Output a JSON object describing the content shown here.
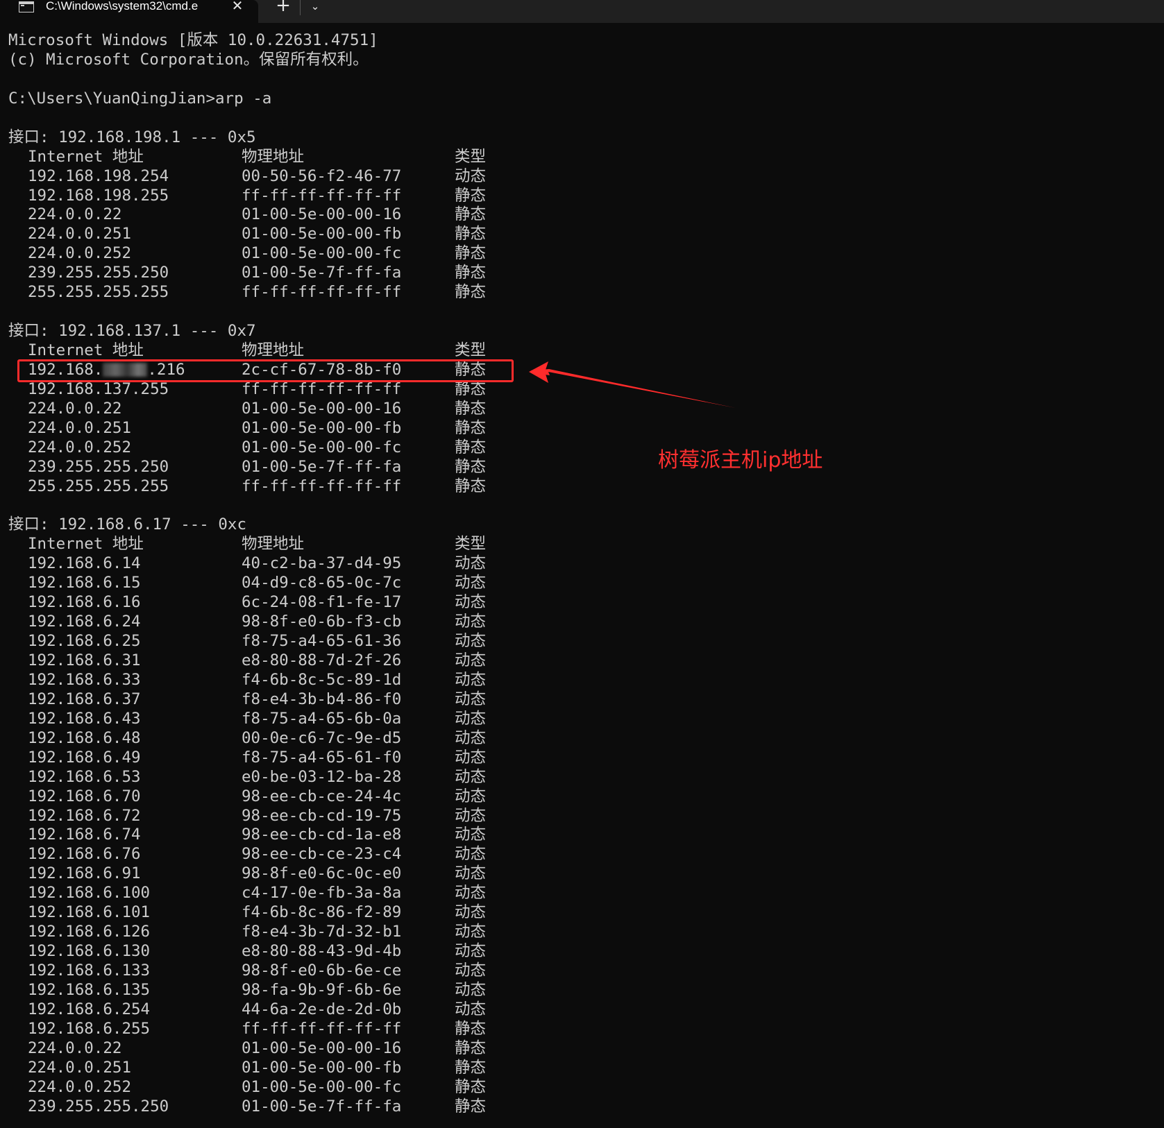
{
  "window": {
    "tab_title": "C:\\Windows\\system32\\cmd.e",
    "close_glyph": "✕",
    "new_tab_glyph": "+",
    "dropdown_glyph": "⌄",
    "icon": "terminal-icon"
  },
  "console": {
    "header_line1": "Microsoft Windows [版本 10.0.22631.4751]",
    "header_line2": "(c) Microsoft Corporation。保留所有权利。",
    "prompt": "C:\\Users\\YuanQingJian>arp -a",
    "interfaces": [
      {
        "title": "接口: 192.168.198.1 --- 0x5",
        "col_ip": "Internet 地址",
        "col_mac": "物理地址",
        "col_type": "类型",
        "rows": [
          {
            "ip": "192.168.198.254",
            "mac": "00-50-56-f2-46-77",
            "type": "动态"
          },
          {
            "ip": "192.168.198.255",
            "mac": "ff-ff-ff-ff-ff-ff",
            "type": "静态"
          },
          {
            "ip": "224.0.0.22",
            "mac": "01-00-5e-00-00-16",
            "type": "静态"
          },
          {
            "ip": "224.0.0.251",
            "mac": "01-00-5e-00-00-fb",
            "type": "静态"
          },
          {
            "ip": "224.0.0.252",
            "mac": "01-00-5e-00-00-fc",
            "type": "静态"
          },
          {
            "ip": "239.255.255.250",
            "mac": "01-00-5e-7f-ff-fa",
            "type": "静态"
          },
          {
            "ip": "255.255.255.255",
            "mac": "ff-ff-ff-ff-ff-ff",
            "type": "静态"
          }
        ]
      },
      {
        "title": "接口: 192.168.137.1 --- 0x7",
        "col_ip": "Internet 地址",
        "col_mac": "物理地址",
        "col_type": "类型",
        "highlight_row": {
          "ip_prefix": "192.168.",
          "ip_suffix": ".216",
          "mac": "2c-cf-67-78-8b-f0",
          "type": "静态"
        },
        "rows": [
          {
            "ip": "192.168.137.255",
            "mac": "ff-ff-ff-ff-ff-ff",
            "type": "静态"
          },
          {
            "ip": "224.0.0.22",
            "mac": "01-00-5e-00-00-16",
            "type": "静态"
          },
          {
            "ip": "224.0.0.251",
            "mac": "01-00-5e-00-00-fb",
            "type": "静态"
          },
          {
            "ip": "224.0.0.252",
            "mac": "01-00-5e-00-00-fc",
            "type": "静态"
          },
          {
            "ip": "239.255.255.250",
            "mac": "01-00-5e-7f-ff-fa",
            "type": "静态"
          },
          {
            "ip": "255.255.255.255",
            "mac": "ff-ff-ff-ff-ff-ff",
            "type": "静态"
          }
        ]
      },
      {
        "title": "接口: 192.168.6.17 --- 0xc",
        "col_ip": "Internet 地址",
        "col_mac": "物理地址",
        "col_type": "类型",
        "rows": [
          {
            "ip": "192.168.6.14",
            "mac": "40-c2-ba-37-d4-95",
            "type": "动态"
          },
          {
            "ip": "192.168.6.15",
            "mac": "04-d9-c8-65-0c-7c",
            "type": "动态"
          },
          {
            "ip": "192.168.6.16",
            "mac": "6c-24-08-f1-fe-17",
            "type": "动态"
          },
          {
            "ip": "192.168.6.24",
            "mac": "98-8f-e0-6b-f3-cb",
            "type": "动态"
          },
          {
            "ip": "192.168.6.25",
            "mac": "f8-75-a4-65-61-36",
            "type": "动态"
          },
          {
            "ip": "192.168.6.31",
            "mac": "e8-80-88-7d-2f-26",
            "type": "动态"
          },
          {
            "ip": "192.168.6.33",
            "mac": "f4-6b-8c-5c-89-1d",
            "type": "动态"
          },
          {
            "ip": "192.168.6.37",
            "mac": "f8-e4-3b-b4-86-f0",
            "type": "动态"
          },
          {
            "ip": "192.168.6.43",
            "mac": "f8-75-a4-65-6b-0a",
            "type": "动态"
          },
          {
            "ip": "192.168.6.48",
            "mac": "00-0e-c6-7c-9e-d5",
            "type": "动态"
          },
          {
            "ip": "192.168.6.49",
            "mac": "f8-75-a4-65-61-f0",
            "type": "动态"
          },
          {
            "ip": "192.168.6.53",
            "mac": "e0-be-03-12-ba-28",
            "type": "动态"
          },
          {
            "ip": "192.168.6.70",
            "mac": "98-ee-cb-ce-24-4c",
            "type": "动态"
          },
          {
            "ip": "192.168.6.72",
            "mac": "98-ee-cb-cd-19-75",
            "type": "动态"
          },
          {
            "ip": "192.168.6.74",
            "mac": "98-ee-cb-cd-1a-e8",
            "type": "动态"
          },
          {
            "ip": "192.168.6.76",
            "mac": "98-ee-cb-ce-23-c4",
            "type": "动态"
          },
          {
            "ip": "192.168.6.91",
            "mac": "98-8f-e0-6c-0c-e0",
            "type": "动态"
          },
          {
            "ip": "192.168.6.100",
            "mac": "c4-17-0e-fb-3a-8a",
            "type": "动态"
          },
          {
            "ip": "192.168.6.101",
            "mac": "f4-6b-8c-86-f2-89",
            "type": "动态"
          },
          {
            "ip": "192.168.6.126",
            "mac": "f8-e4-3b-7d-32-b1",
            "type": "动态"
          },
          {
            "ip": "192.168.6.130",
            "mac": "e8-80-88-43-9d-4b",
            "type": "动态"
          },
          {
            "ip": "192.168.6.133",
            "mac": "98-8f-e0-6b-6e-ce",
            "type": "动态"
          },
          {
            "ip": "192.168.6.135",
            "mac": "98-fa-9b-9f-6b-6e",
            "type": "动态"
          },
          {
            "ip": "192.168.6.254",
            "mac": "44-6a-2e-de-2d-0b",
            "type": "动态"
          },
          {
            "ip": "192.168.6.255",
            "mac": "ff-ff-ff-ff-ff-ff",
            "type": "静态"
          },
          {
            "ip": "224.0.0.22",
            "mac": "01-00-5e-00-00-16",
            "type": "静态"
          },
          {
            "ip": "224.0.0.251",
            "mac": "01-00-5e-00-00-fb",
            "type": "静态"
          },
          {
            "ip": "224.0.0.252",
            "mac": "01-00-5e-00-00-fc",
            "type": "静态"
          },
          {
            "ip": "239.255.255.250",
            "mac": "01-00-5e-7f-ff-fa",
            "type": "静态"
          }
        ]
      }
    ]
  },
  "annotation": {
    "text": "树莓派主机ip地址",
    "color": "#ff3030"
  },
  "colors": {
    "background": "#0c0c0c",
    "text": "#cccccc",
    "highlight_border": "#ff2b2b"
  }
}
